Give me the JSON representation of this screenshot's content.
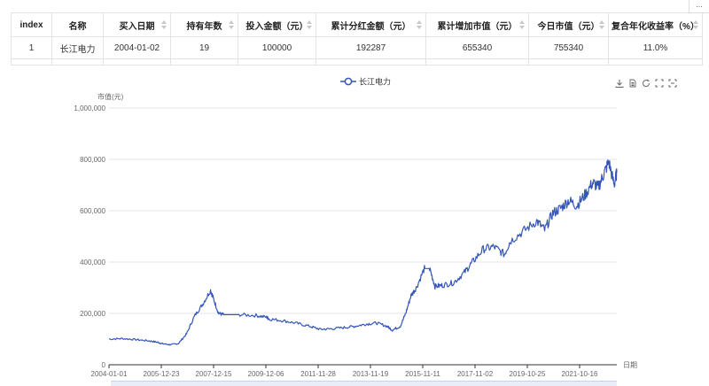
{
  "table": {
    "headers": [
      "index",
      "名称",
      "买入日期",
      "持有年数",
      "投入金额（元）",
      "累计分红金额（元）",
      "累计增加市值（元）",
      "今日市值（元）",
      "复合年化收益率（%）"
    ],
    "rows": [
      [
        "1",
        "长江电力",
        "2004-01-02",
        "19",
        "100000",
        "192287",
        "655340",
        "755340",
        "11.0%"
      ]
    ]
  },
  "corner_label": "...",
  "toolbox_icons": [
    "download-icon",
    "data-view-icon",
    "restore-icon",
    "zoom-icon",
    "zoom-reset-icon"
  ],
  "chart_data": {
    "type": "line",
    "title": "",
    "xlabel": "日期",
    "ylabel": "市值(元)",
    "ylim": [
      0,
      1000000
    ],
    "y_ticks": [
      "0",
      "200,000",
      "400,000",
      "600,000",
      "800,000",
      "1,000,000"
    ],
    "x_ticks": [
      "2004-01-01",
      "2005-12-23",
      "2007-12-15",
      "2009-12-06",
      "2011-11-28",
      "2013-11-19",
      "2015-11-11",
      "2017-11-02",
      "2019-10-25",
      "2021-10-16"
    ],
    "legend_position": "top-center",
    "grid": true,
    "line_color": "#3556b8",
    "series": [
      {
        "name": "长江电力",
        "x": [
          2004.0,
          2004.5,
          2005.0,
          2005.5,
          2005.8,
          2006.0,
          2006.3,
          2006.6,
          2006.9,
          2007.2,
          2007.5,
          2007.8,
          2007.9,
          2008.1,
          2008.3,
          2008.5,
          2008.9,
          2009.5,
          2009.9,
          2010.0,
          2010.5,
          2011.0,
          2011.5,
          2011.9,
          2012.3,
          2012.8,
          2013.2,
          2013.6,
          2014.0,
          2014.4,
          2014.6,
          2014.9,
          2015.1,
          2015.3,
          2015.5,
          2015.8,
          2016.0,
          2016.2,
          2016.5,
          2016.9,
          2017.3,
          2017.6,
          2018.0,
          2018.4,
          2018.8,
          2019.0,
          2019.5,
          2020.0,
          2020.3,
          2020.6,
          2020.9,
          2021.2,
          2021.5,
          2021.8,
          2022.1,
          2022.3,
          2022.5,
          2022.7,
          2022.9,
          2023.0
        ],
        "values": [
          100000,
          102000,
          98000,
          93000,
          88000,
          82000,
          78000,
          83000,
          120000,
          190000,
          235000,
          290000,
          260000,
          200000,
          195000,
          195000,
          195000,
          192000,
          185000,
          178000,
          172000,
          162000,
          150000,
          138000,
          140000,
          145000,
          150000,
          158000,
          163000,
          150000,
          135000,
          150000,
          200000,
          270000,
          300000,
          375000,
          375000,
          305000,
          310000,
          320000,
          360000,
          400000,
          450000,
          460000,
          430000,
          480000,
          520000,
          560000,
          525000,
          590000,
          610000,
          640000,
          620000,
          660000,
          710000,
          690000,
          740000,
          790000,
          700000,
          750000
        ]
      }
    ]
  }
}
